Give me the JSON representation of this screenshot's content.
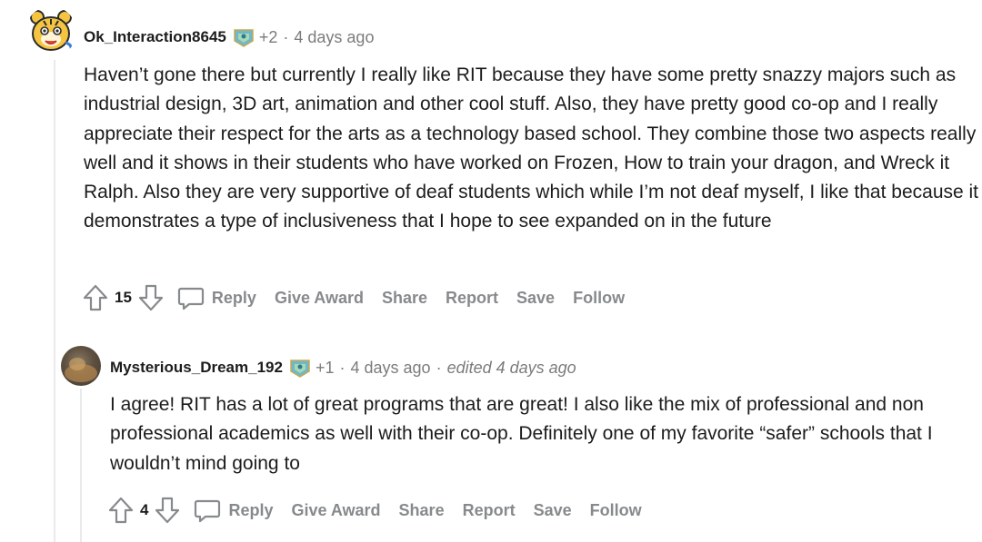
{
  "comments": [
    {
      "username": "Ok_Interaction8645",
      "karma": "+2",
      "separator": "·",
      "time": "4 days ago",
      "award_icon": "achievement-badge-icon",
      "body": "Haven’t gone there but currently I really like RIT because they have some pretty snazzy majors such as industrial design, 3D art, animation and other cool stuff. Also, they have pretty good co-op and I really appreciate their respect for the arts as a technology based school. They combine those two aspects really well and it shows in their students who have worked on Frozen, How to train your dragon, and Wreck it Ralph. Also they are very supportive of deaf students which while I’m not deaf myself, I like that because it demonstrates a type of inclusiveness that I hope to see expanded on in the future",
      "score": "15",
      "actions": {
        "reply": "Reply",
        "give_award": "Give Award",
        "share": "Share",
        "report": "Report",
        "save": "Save",
        "follow": "Follow"
      }
    },
    {
      "username": "Mysterious_Dream_192",
      "karma": "+1",
      "separator": "·",
      "time": "4 days ago",
      "edited": "edited 4 days ago",
      "award_icon": "achievement-badge-icon",
      "body": "I agree! RIT has a lot of great programs that are great! I also like the mix of professional and non professional academics as well with their co-op. Definitely one of my favorite “safer” schools that I wouldn’t mind going to",
      "score": "4",
      "actions": {
        "reply": "Reply",
        "give_award": "Give Award",
        "share": "Share",
        "report": "Report",
        "save": "Save",
        "follow": "Follow"
      }
    }
  ],
  "colors": {
    "text": "#1c1c1c",
    "meta": "#7c7c7c",
    "actions": "#878a8c",
    "thread_line": "#e9eaeb"
  }
}
